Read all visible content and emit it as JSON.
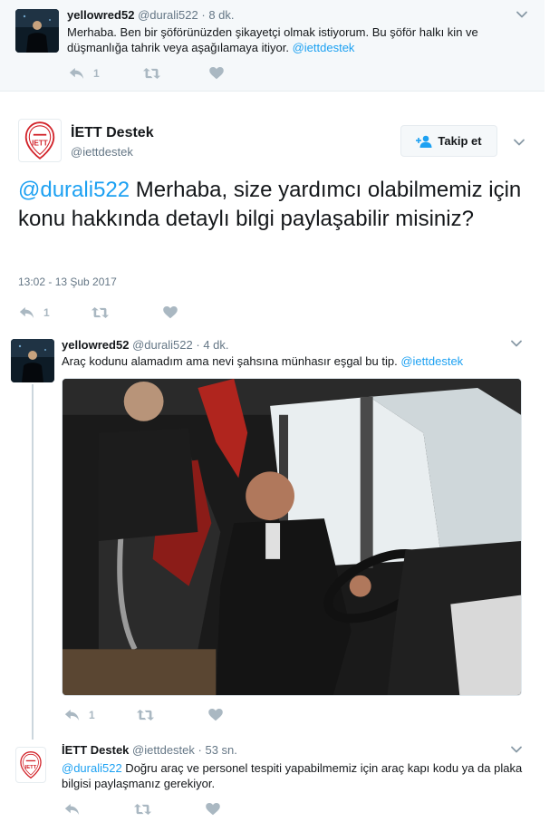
{
  "tweets": {
    "top": {
      "name": "yellowred52",
      "handle": "@durali522",
      "separator": "·",
      "time": "8 dk.",
      "text": "Merhaba. Ben bir şöförünüzden şikayetçi olmak istiyorum. Bu şöför halkı kin ve düşmanlığa tahrik veya aşağılamaya itiyor. ",
      "mention": "@iettdestek",
      "reply_count": "1"
    },
    "main": {
      "name": "İETT Destek",
      "handle": "@iettdestek",
      "follow_label": "Takip et",
      "mention": "@durali522",
      "text": " Merhaba, size yardımcı olabilmemiz için konu hakkında detaylı bilgi paylaşabilir misiniz?",
      "timestamp": "13:02 - 13 Şub 2017",
      "reply_count": "1"
    },
    "reply1": {
      "name": "yellowred52",
      "handle": "@durali522",
      "separator": "·",
      "time": "4 dk.",
      "text": "Araç kodunu alamadım ama nevi şahsına münhasır eşgal bu tip. ",
      "mention": "@iettdestek",
      "reply_count": "1"
    },
    "reply2": {
      "name": "İETT Destek",
      "handle": "@iettdestek",
      "separator": "·",
      "time": "53 sn.",
      "mention": "@durali522",
      "text": " Doğru araç ve personel tespiti yapabilmemiz için araç kapı kodu ya da plaka bilgisi paylaşmanız gerekiyor."
    }
  },
  "icons": {
    "reply": "reply-icon",
    "retweet": "retweet-icon",
    "like": "heart-icon",
    "more": "chevron-down-icon",
    "follow": "add-user-icon"
  },
  "colors": {
    "link": "#1da1f2",
    "muted": "#657786",
    "action": "#aab8c2",
    "iett_red": "#d2232a"
  }
}
